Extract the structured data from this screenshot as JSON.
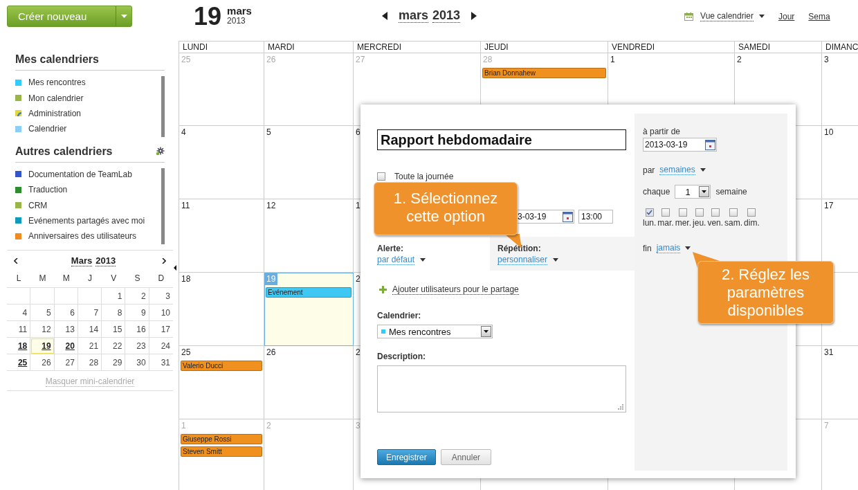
{
  "toolbar": {
    "create_button": "Créer nouveau",
    "date": {
      "day": "19",
      "month": "mars",
      "year": "2013"
    },
    "nav": {
      "month": "mars",
      "year": "2013"
    },
    "view_menu": "Vue calendrier",
    "views": [
      {
        "label": "Jour"
      },
      {
        "label": "Sema"
      }
    ]
  },
  "sidebar": {
    "my_calendars": {
      "title": "Mes calendriers",
      "items": [
        {
          "label": "Mes rencontres",
          "color": "#33ccff",
          "kind": "plain"
        },
        {
          "label": "Mon calendrier",
          "color": "#99b548",
          "kind": "plain"
        },
        {
          "label": "Administration",
          "color": "#e0d83c",
          "kind": "shared"
        },
        {
          "label": "Calendrier",
          "color": "#8ccff5",
          "kind": "plain"
        }
      ]
    },
    "other_calendars": {
      "title": "Autres calendriers",
      "items": [
        {
          "label": "Documentation de TeamLab",
          "color": "#3355cc",
          "kind": "plain"
        },
        {
          "label": "Traduction",
          "color": "#2e8b2e",
          "kind": "plain"
        },
        {
          "label": "CRM",
          "color": "#99b548",
          "kind": "plain"
        },
        {
          "label": "Evénements partagés avec moi",
          "color": "#1199bb",
          "kind": "plain"
        },
        {
          "label": "Anniversaires des utilisateurs",
          "color": "#f08c1e",
          "kind": "plain"
        }
      ]
    },
    "mini_calendar": {
      "month": "Mars",
      "year": "2013",
      "weekdays": [
        "L",
        "M",
        "M",
        "J",
        "V",
        "S",
        "D"
      ],
      "weeks": [
        [
          {
            "day": "1",
            "selected": false,
            "has_events": false
          },
          {
            "day": "2",
            "selected": false,
            "has_events": false
          },
          {
            "day": "3",
            "selected": false,
            "has_events": false
          }
        ],
        [
          {
            "day": "4",
            "selected": false,
            "has_events": false
          },
          {
            "day": "5",
            "selected": false,
            "has_events": false
          },
          {
            "day": "6",
            "selected": false,
            "has_events": false
          },
          {
            "day": "7",
            "selected": false,
            "has_events": false
          },
          {
            "day": "8",
            "selected": false,
            "has_events": false
          },
          {
            "day": "9",
            "selected": false,
            "has_events": false
          },
          {
            "day": "10",
            "selected": false,
            "has_events": false
          }
        ],
        [
          {
            "day": "11",
            "selected": false,
            "has_events": false
          },
          {
            "day": "12",
            "selected": false,
            "has_events": false
          },
          {
            "day": "13",
            "selected": false,
            "has_events": false
          },
          {
            "day": "14",
            "selected": false,
            "has_events": false
          },
          {
            "day": "15",
            "selected": false,
            "has_events": false
          },
          {
            "day": "16",
            "selected": false,
            "has_events": false
          },
          {
            "day": "17",
            "selected": false,
            "has_events": false
          }
        ],
        [
          {
            "day": "18",
            "selected": false,
            "has_events": true
          },
          {
            "day": "19",
            "selected": true,
            "has_events": true
          },
          {
            "day": "20",
            "selected": false,
            "has_events": true
          },
          {
            "day": "21",
            "selected": false,
            "has_events": false
          },
          {
            "day": "22",
            "selected": false,
            "has_events": false
          },
          {
            "day": "23",
            "selected": false,
            "has_events": false
          },
          {
            "day": "24",
            "selected": false,
            "has_events": false
          }
        ],
        [
          {
            "day": "25",
            "selected": false,
            "has_events": true
          },
          {
            "day": "26",
            "selected": false,
            "has_events": false
          },
          {
            "day": "27",
            "selected": false,
            "has_events": false
          },
          {
            "day": "28",
            "selected": false,
            "has_events": false
          },
          {
            "day": "29",
            "selected": false,
            "has_events": false
          },
          {
            "day": "30",
            "selected": false,
            "has_events": false
          },
          {
            "day": "31",
            "selected": false,
            "has_events": false
          }
        ]
      ],
      "hide_link": "Masquer mini-calendrier"
    }
  },
  "calendar": {
    "columns": [
      "LUNDI",
      "MARDI",
      "MERCREDI",
      "JEUDI",
      "VENDREDI",
      "SAMEDI",
      "DIMANC"
    ],
    "weeks": [
      {
        "left_cells": [
          {
            "day": "25",
            "muted": true,
            "selected": false
          },
          {
            "day": "26",
            "muted": true,
            "selected": false
          },
          {
            "day": "27",
            "muted": true,
            "selected": false
          },
          {
            "day": "28",
            "muted": true,
            "selected": false,
            "events": [
              {
                "title": "Brian Donnahew",
                "color": "#f0901e"
              }
            ]
          },
          {
            "day": "1",
            "muted": false,
            "selected": false
          },
          {
            "day": "2",
            "muted": false,
            "selected": false
          },
          {
            "day": "3",
            "muted": false,
            "selected": false
          }
        ]
      },
      {
        "left_cells": [
          {
            "day": "4",
            "muted": false,
            "selected": false
          },
          {
            "day": "5",
            "muted": false,
            "selected": false
          },
          {
            "day": "6",
            "muted": false,
            "selected": false
          }
        ],
        "right_cells": [
          {
            "day": "10",
            "muted": false,
            "selected": false
          }
        ]
      },
      {
        "left_cells": [
          {
            "day": "11",
            "muted": false,
            "selected": false
          },
          {
            "day": "12",
            "muted": false,
            "selected": false
          },
          {
            "day": "1",
            "muted": false,
            "selected": false
          }
        ],
        "right_cells": [
          {
            "day": "17",
            "muted": false,
            "selected": false
          }
        ]
      },
      {
        "left_cells": [
          {
            "day": "18",
            "muted": false,
            "selected": false
          },
          {
            "day": "19",
            "muted": false,
            "selected": true,
            "events": [
              {
                "title": "Evénement",
                "color": "#40c8f4"
              }
            ]
          },
          {
            "day": "2",
            "muted": false,
            "selected": false
          }
        ]
      },
      {
        "left_cells": [
          {
            "day": "25",
            "muted": false,
            "selected": false,
            "events": [
              {
                "title": "Valerio Ducci",
                "color": "#f0901e"
              }
            ]
          },
          {
            "day": "26",
            "muted": false,
            "selected": false
          },
          {
            "day": "2",
            "muted": false,
            "selected": false
          }
        ],
        "right_cells": [
          {
            "day": "31",
            "muted": false,
            "selected": false
          }
        ]
      },
      {
        "left_cells": [
          {
            "day": "1",
            "muted": true,
            "selected": false,
            "events": [
              {
                "title": "Giuseppe Rossi",
                "color": "#f0901e"
              },
              {
                "title": "Steven Smitt",
                "color": "#f0901e"
              }
            ]
          },
          {
            "day": "2",
            "muted": true,
            "selected": false
          },
          {
            "day": "3",
            "muted": true,
            "selected": false
          }
        ],
        "right_cells": [
          {
            "day": "7",
            "muted": true,
            "selected": false
          }
        ]
      }
    ]
  },
  "event_dialog": {
    "title_value": "Rapport hebdomadaire",
    "all_day": {
      "label": "Toute la journée",
      "checked": false
    },
    "start_date": "3-03-19",
    "start_time": "13:00",
    "alert": {
      "label": "Alerte:",
      "value": "par défaut"
    },
    "repeat": {
      "label": "Répétition:",
      "value": "personnaliser"
    },
    "share_link": "Ajouter utilisateurs pour le partage",
    "calendar": {
      "label": "Calendrier:",
      "value": "Mes rencontres",
      "color": "#33ccff"
    },
    "description": {
      "label": "Description:"
    },
    "save_button": "Enregistrer",
    "cancel_button": "Annuler",
    "repeat_panel": {
      "from_label": "à partir de",
      "from_value": "2013-03-19",
      "by_label": "par",
      "by_value": "semaines",
      "every_label": "chaque",
      "every_value": "1",
      "every_unit": "semaine",
      "weekdays": [
        {
          "label": "lun.",
          "checked": true
        },
        {
          "label": "mar.",
          "checked": false
        },
        {
          "label": "mer.",
          "checked": false
        },
        {
          "label": "jeu.",
          "checked": false
        },
        {
          "label": "ven.",
          "checked": false
        },
        {
          "label": "sam.",
          "checked": false
        },
        {
          "label": "dim.",
          "checked": false
        }
      ],
      "end_label": "fin",
      "end_value": "jamais"
    }
  },
  "callouts": [
    {
      "text": "1. Sélectionnez cette option"
    },
    {
      "text": "2. Réglez les paramètres disponibles"
    }
  ]
}
